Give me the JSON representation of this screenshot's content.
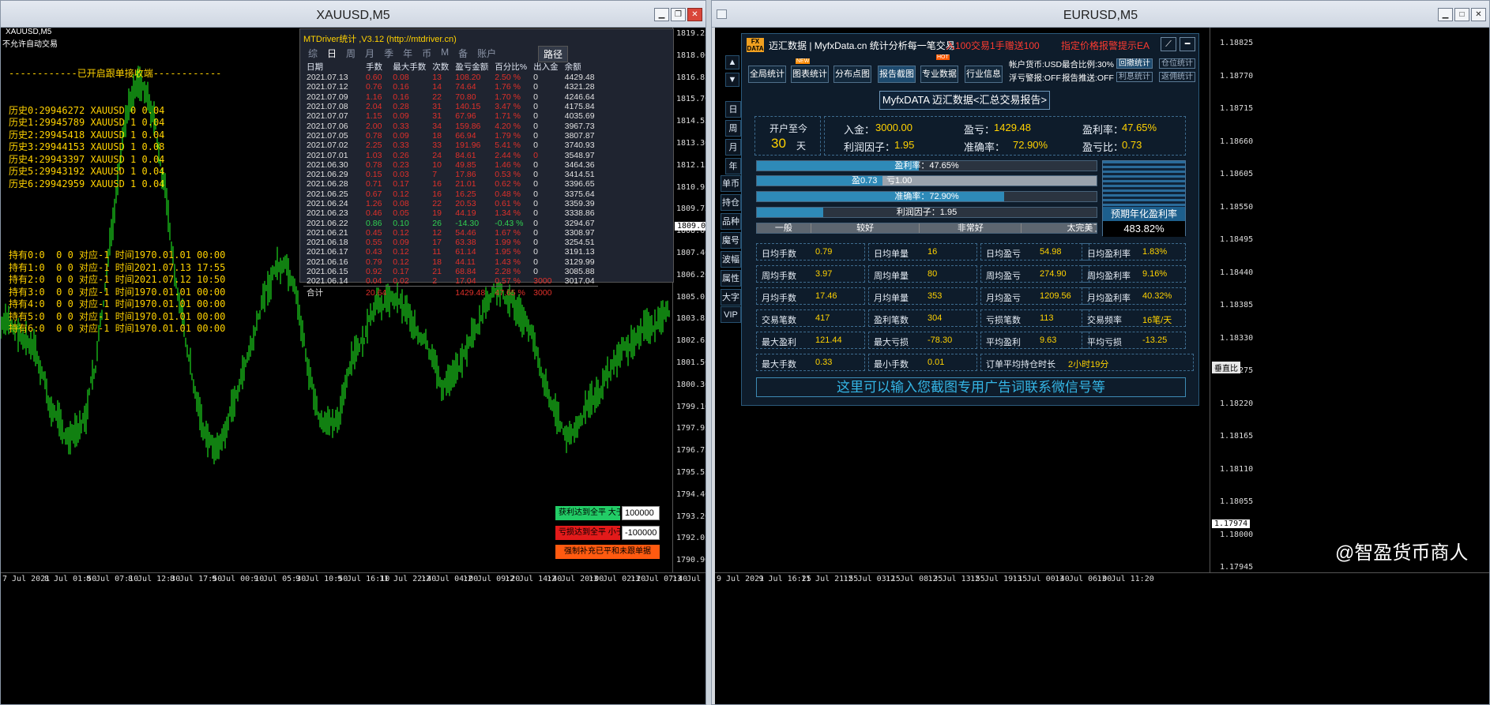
{
  "left_window": {
    "title": "XAUUSD,M5",
    "chart_label": "XAUUSD,M5",
    "top_hint": "不允许自动交易",
    "header_line": "------------已开启跟单接收端------------",
    "history_lines": [
      "历史0:29946272 XAUUSD 0 0.04",
      "历史1:29945789 XAUUSD 1 0.04",
      "历史2:29945418 XAUUSD 1 0.04",
      "历史3:29944153 XAUUSD 1 0.08",
      "历史4:29943397 XAUUSD 1 0.04",
      "历史5:29943192 XAUUSD 1 0.04",
      "历史6:29942959 XAUUSD 1 0.04"
    ],
    "hold_lines": [
      "持有0:0  0 0 对应-1 时间1970.01.01 00:00",
      "持有1:0  0 0 对应-1 时间2021.07.13 17:55",
      "持有2:0  0 0 对应-1 时间2021.07.12 10:50",
      "持有3:0  0 0 对应-1 时间1970.01.01 00:00",
      "持有4:0  0 0 对应-1 时间1970.01.01 00:00",
      "持有5:0  0 0 对应-1 时间1970.01.01 00:00",
      "持有6:0  0 0 对应-1 时间1970.01.01 00:00"
    ],
    "price_labels": [
      "1819.25",
      "1818.00",
      "1816.85",
      "1815.70",
      "1814.55",
      "1813.30",
      "1812.15",
      "1810.95",
      "1809.75",
      "1808.60",
      "1807.40",
      "1806.20",
      "1805.05",
      "1803.85",
      "1802.65",
      "1801.50",
      "1800.30",
      "1799.10",
      "1797.95",
      "1796.75",
      "1795.55",
      "1794.40",
      "1793.20",
      "1792.05",
      "1790.90"
    ],
    "current_price": "1809.03",
    "time_labels": [
      "7 Jul 2021",
      "8 Jul 01:50",
      "8 Jul 07:10",
      "8 Jul 12:30",
      "8 Jul 17:50",
      "9 Jul 00:10",
      "9 Jul 05:30",
      "9 Jul 10:50",
      "9 Jul 16:10",
      "11 Jul 22:40",
      "12 Jul 04:00",
      "12 Jul 09:20",
      "12 Jul 14:40",
      "12 Jul 20:00",
      "13 Jul 02:20",
      "13 Jul 07:40",
      "13 Jul 13:00"
    ],
    "controls": {
      "tp_label": "获利达到全平 大于",
      "tp_value": "100000",
      "sl_label": "亏损达到全平 小于",
      "sl_value": "-100000",
      "force_label": "强制补充已平和未跟单据"
    }
  },
  "history_panel": {
    "title": "MTDriver统计 ,V3.12 (http://mtdriver.cn)",
    "tabs": [
      "综",
      "日",
      "周",
      "月",
      "季",
      "年",
      "币",
      "M",
      "备",
      "账户"
    ],
    "active_tab": "日",
    "path_button": "路径",
    "columns": [
      "日期",
      "手数",
      "最大手数",
      "次数",
      "盈亏金额",
      "百分比%",
      "出入金",
      "余额"
    ],
    "rows": [
      [
        "2021.07.13",
        "0.60",
        "0.08",
        "13",
        "108.20",
        "2.50 %",
        "0",
        "4429.48"
      ],
      [
        "2021.07.12",
        "0.76",
        "0.16",
        "14",
        "74.64",
        "1.76 %",
        "0",
        "4321.28"
      ],
      [
        "2021.07.09",
        "1.16",
        "0.16",
        "22",
        "70.80",
        "1.70 %",
        "0",
        "4246.64"
      ],
      [
        "2021.07.08",
        "2.04",
        "0.28",
        "31",
        "140.15",
        "3.47 %",
        "0",
        "4175.84"
      ],
      [
        "2021.07.07",
        "1.15",
        "0.09",
        "31",
        "67.96",
        "1.71 %",
        "0",
        "4035.69"
      ],
      [
        "2021.07.06",
        "2.00",
        "0.33",
        "34",
        "159.86",
        "4.20 %",
        "0",
        "3967.73"
      ],
      [
        "2021.07.05",
        "0.78",
        "0.09",
        "18",
        "66.94",
        "1.79 %",
        "0",
        "3807.87"
      ],
      [
        "2021.07.02",
        "2.25",
        "0.33",
        "33",
        "191.96",
        "5.41 %",
        "0",
        "3740.93"
      ],
      [
        "2021.07.01",
        "1.03",
        "0.26",
        "24",
        "84.61",
        "2.44 %",
        "0",
        "3548.97"
      ],
      [
        "2021.06.30",
        "0.78",
        "0.23",
        "10",
        "49.85",
        "1.46 %",
        "0",
        "3464.36"
      ],
      [
        "2021.06.29",
        "0.15",
        "0.03",
        "7",
        "17.86",
        "0.53 %",
        "0",
        "3414.51"
      ],
      [
        "2021.06.28",
        "0.71",
        "0.17",
        "16",
        "21.01",
        "0.62 %",
        "0",
        "3396.65"
      ],
      [
        "2021.06.25",
        "0.67",
        "0.12",
        "16",
        "16.25",
        "0.48 %",
        "0",
        "3375.64"
      ],
      [
        "2021.06.24",
        "1.26",
        "0.08",
        "22",
        "20.53",
        "0.61 %",
        "0",
        "3359.39"
      ],
      [
        "2021.06.23",
        "0.46",
        "0.05",
        "19",
        "44.19",
        "1.34 %",
        "0",
        "3338.86"
      ],
      [
        "2021.06.22",
        "0.86",
        "0.10",
        "26",
        "-14.30",
        "-0.43 %",
        "0",
        "3294.67"
      ],
      [
        "2021.06.21",
        "0.45",
        "0.12",
        "12",
        "54.46",
        "1.67 %",
        "0",
        "3308.97"
      ],
      [
        "2021.06.18",
        "0.55",
        "0.09",
        "17",
        "63.38",
        "1.99 %",
        "0",
        "3254.51"
      ],
      [
        "2021.06.17",
        "0.43",
        "0.12",
        "11",
        "61.14",
        "1.95 %",
        "0",
        "3191.13"
      ],
      [
        "2021.06.16",
        "0.79",
        "0.12",
        "18",
        "44.11",
        "1.43 %",
        "0",
        "3129.99"
      ],
      [
        "2021.06.15",
        "0.92",
        "0.17",
        "21",
        "68.84",
        "2.28 %",
        "0",
        "3085.88"
      ],
      [
        "2021.06.14",
        "0.04",
        "0.02",
        "2",
        "17.04",
        "0.57 %",
        "3000",
        "3017.04"
      ]
    ],
    "total": [
      "合计",
      "20.64",
      "",
      "",
      "1429.48",
      "47.65 %",
      "3000",
      ""
    ]
  },
  "right_window": {
    "title": "EURUSD,M5",
    "price_labels": [
      "1.18825",
      "1.18770",
      "1.18715",
      "1.18660",
      "1.18605",
      "1.18550",
      "1.18495",
      "1.18440",
      "1.18385",
      "1.18330",
      "1.18275",
      "1.18220",
      "1.18165",
      "1.18110",
      "1.18055",
      "1.18000",
      "1.17945"
    ],
    "current_price": "1.17974",
    "current_extra": "垂直比",
    "time_labels": [
      "9 Jul 2021",
      "9 Jul 16:25",
      "11 Jul 21:55",
      "12 Jul 03:15",
      "12 Jul 08:35",
      "12 Jul 13:55",
      "12 Jul 19:15",
      "13 Jul 00:40",
      "13 Jul 06:00",
      "13 Jul 11:20"
    ],
    "side_buttons": [
      "日",
      "周",
      "月",
      "年",
      "单币",
      "持仓",
      "品种",
      "魔号",
      "波幅",
      "属性",
      "大字",
      "VIP"
    ],
    "watermark": "@智盈货币商人"
  },
  "dashboard": {
    "logo": "FX DATA",
    "header": "迈汇数据 | MyfxData.cn   统计分析每一笔交易",
    "promo1": "入100交易1手赠送100",
    "promo2": "指定价格报警提示EA",
    "nav": [
      "全局统计",
      "图表统计",
      "分布点图",
      "报告截图",
      "专业数据",
      "行业信息"
    ],
    "active_nav": "报告截图",
    "badge_new": "NEW",
    "badge_hot": "HOT",
    "acct_currency": "帐户货币:USD",
    "acct_margin": "最合比例:30%",
    "acct_float": "浮亏警报:OFF",
    "acct_push": "报告推送:OFF",
    "acct_buttons": [
      "回撤统计",
      "仓位统计",
      "利息统计",
      "返佣统计"
    ],
    "report_title": "MyfxDATA 迈汇数据<汇总交易报告>",
    "since_label": "开户至今",
    "since_days": "30",
    "since_unit": "天",
    "summary": {
      "deposit_label": "入金：",
      "deposit": "3000.00",
      "profit_label": "盈亏：",
      "profit": "1429.48",
      "rate_label": "盈利率：",
      "rate": "47.65%",
      "pf_label": "利润因子：",
      "pf": "1.95",
      "acc_label": "准确率：",
      "acc": "72.90%",
      "ratio_label": "盈亏比：",
      "ratio": "0.73"
    },
    "bars": {
      "rate_text": "盈利率：47.65%",
      "rate_frac": 0.4765,
      "win_text": "盈0.73",
      "loss_text": "亏1.00",
      "acc_text": "准确率：72.90%",
      "acc_frac": 0.729,
      "pf_text": "利润因子：1.95"
    },
    "rating": [
      "一般",
      "较好",
      "非常好",
      "太完美了"
    ],
    "annual_label": "预期年化盈利率",
    "annual_value": "483.82%",
    "stats": [
      [
        "日均手数",
        "0.79",
        "日均单量",
        "16",
        "日均盈亏",
        "54.98",
        "日均盈利率",
        "1.83%"
      ],
      [
        "周均手数",
        "3.97",
        "周均单量",
        "80",
        "周均盈亏",
        "274.90",
        "周均盈利率",
        "9.16%"
      ],
      [
        "月均手数",
        "17.46",
        "月均单量",
        "353",
        "月均盈亏",
        "1209.56",
        "月均盈利率",
        "40.32%"
      ],
      [
        "交易笔数",
        "417",
        "盈利笔数",
        "304",
        "亏损笔数",
        "113",
        "交易频率",
        "16笔/天"
      ],
      [
        "最大盈利",
        "121.44",
        "最大亏损",
        "-78.30",
        "平均盈利",
        "9.63",
        "平均亏损",
        "-13.25"
      ],
      [
        "最大手数",
        "0.33",
        "最小手数",
        "0.01",
        "订单平均持仓时长",
        "2小时19分"
      ]
    ],
    "ad": "这里可以输入您截图专用广告词联系微信号等"
  },
  "colors": {
    "chart_bg": "#000000",
    "candle": "#22ff22",
    "panel_bg": "#0e1c2b",
    "accent": "#ffd200",
    "loss": "#e0302a"
  }
}
